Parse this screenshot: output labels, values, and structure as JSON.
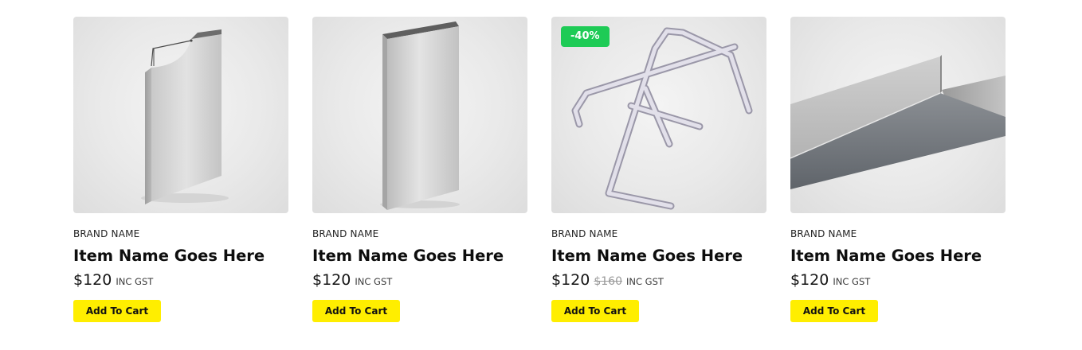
{
  "products": [
    {
      "brand": "BRAND NAME",
      "name": "Item Name Goes Here",
      "price": "$120",
      "old_price": "",
      "tax_label": "INC GST",
      "badge": "",
      "cart_label": "Add To Cart",
      "image_icon": "cut-steel-panel-icon"
    },
    {
      "brand": "BRAND NAME",
      "name": "Item Name Goes Here",
      "price": "$120",
      "old_price": "",
      "tax_label": "INC GST",
      "badge": "",
      "cart_label": "Add To Cart",
      "image_icon": "steel-panel-icon"
    },
    {
      "brand": "BRAND NAME",
      "name": "Item Name Goes Here",
      "price": "$120",
      "old_price": "$160",
      "tax_label": "INC GST",
      "badge": "-40%",
      "cart_label": "Add To Cart",
      "image_icon": "bent-steel-rods-icon"
    },
    {
      "brand": "BRAND NAME",
      "name": "Item Name Goes Here",
      "price": "$120",
      "old_price": "",
      "tax_label": "INC GST",
      "badge": "",
      "cart_label": "Add To Cart",
      "image_icon": "steel-angle-bar-icon"
    }
  ],
  "colors": {
    "cart_button": "#ffee00",
    "discount_badge": "#1ecb56",
    "image_background": "#e9e9e9"
  }
}
